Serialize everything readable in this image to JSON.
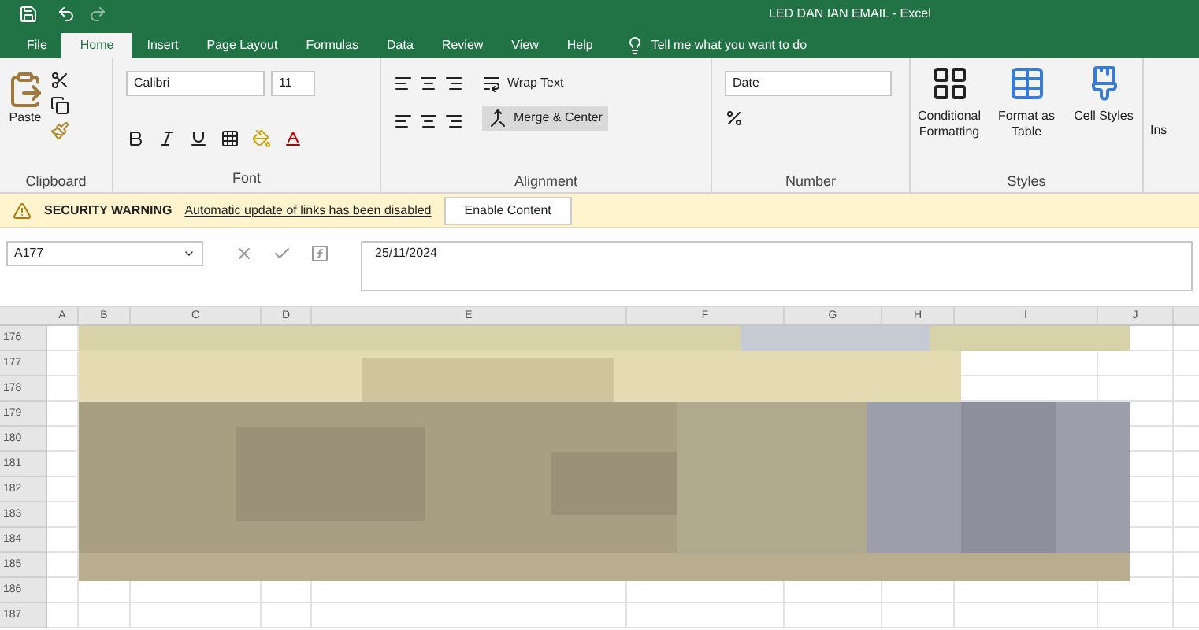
{
  "window": {
    "title": "LED DAN IAN EMAIL - Excel"
  },
  "tabs": [
    {
      "label": "File",
      "selected": false
    },
    {
      "label": "Home",
      "selected": true
    },
    {
      "label": "Insert",
      "selected": false
    },
    {
      "label": "Page Layout",
      "selected": false
    },
    {
      "label": "Formulas",
      "selected": false
    },
    {
      "label": "Data",
      "selected": false
    },
    {
      "label": "Review",
      "selected": false
    },
    {
      "label": "View",
      "selected": false
    },
    {
      "label": "Help",
      "selected": false
    }
  ],
  "tell_me": "Tell me what you want to do",
  "ribbon": {
    "clipboard": {
      "paste": "Paste",
      "label": "Clipboard"
    },
    "font": {
      "name": "Calibri",
      "size": "11",
      "label": "Font"
    },
    "alignment": {
      "wrap": "Wrap Text",
      "merge": "Merge & Center",
      "label": "Alignment"
    },
    "number": {
      "format": "Date",
      "label": "Number"
    },
    "styles": {
      "items": [
        "Conditional Formatting",
        "Format as Table",
        "Cell Styles"
      ],
      "label": "Styles"
    },
    "insert": "Ins"
  },
  "security": {
    "label": "SECURITY WARNING",
    "message": "Automatic update of links has been disabled",
    "button": "Enable Content"
  },
  "formula_bar": {
    "name_box": "A177",
    "value": "25/11/2024"
  },
  "columns": [
    "A",
    "B",
    "C",
    "D",
    "E",
    "F",
    "G",
    "H",
    "I",
    "J"
  ],
  "rows": [
    "176",
    "177",
    "178",
    "179",
    "180",
    "181",
    "182",
    "183",
    "184",
    "185",
    "186",
    "187"
  ]
}
